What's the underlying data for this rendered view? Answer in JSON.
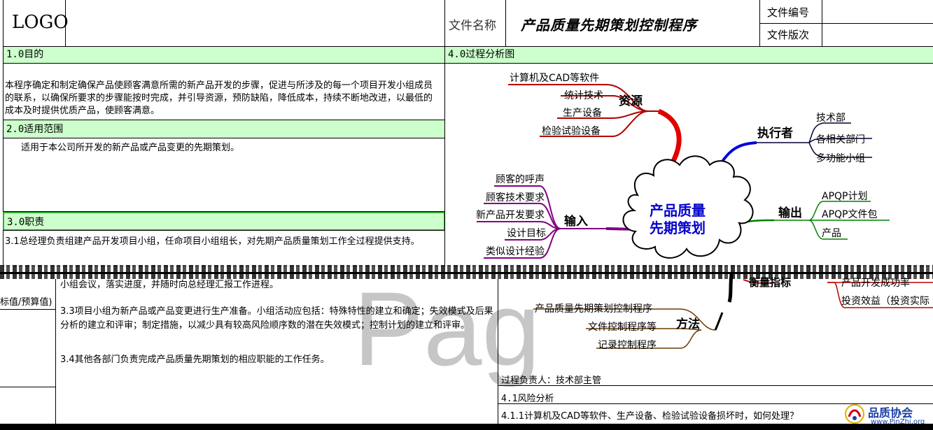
{
  "header": {
    "logo": "LOGO",
    "doc_name_label": "文件名称",
    "doc_title": "产品质量先期策划控制程序",
    "doc_no_label": "文件编号",
    "doc_version_label": "文件版次"
  },
  "left": {
    "s1_title": "1.0目的",
    "s1_body": "本程序确定和制定确保产品使顾客满意所需的新产品开发的步骤，促进与所涉及的每一个项目开发小组成员的联系，以确保所要求的步骤能按时完成，并引导资源，预防缺陷，降低成本，持续不断地改进，以最低的成本及时提供优质产品，使顾客满意。",
    "s2_title": "2.0适用范围",
    "s2_body": "适用于本公司所开发的新产品或产品变更的先期策划。",
    "s3_title": "3.0职责",
    "s3_1": "3.1总经理负责组建产品开发项目小组，任命项目小组组长，对先期产品质量策划工作全过程提供支持。"
  },
  "right": {
    "s4_title": "4.0过程分析图",
    "center_line1": "产品质量",
    "center_line2": "先期策划",
    "resources_label": "资源",
    "resources": [
      "计算机及CAD等软件",
      "统计技术",
      "生产设备",
      "检验试验设备"
    ],
    "executor_label": "执行者",
    "executors": [
      "技术部",
      "各相关部门",
      "多功能小组"
    ],
    "input_label": "输入",
    "inputs": [
      "顾客的呼声",
      "顾客技术要求",
      "新产品开发要求",
      "设计目标",
      "类似设计经验"
    ],
    "output_label": "输出",
    "outputs": [
      "APQP计划",
      "APQP文件包",
      "产品"
    ]
  },
  "lower": {
    "left_col_text": "标值/预算值)",
    "s3_2_tail": "小组会议，落实进度，并随时向总经理汇报工作进程。",
    "s3_3": "3.3项目小组为新产品或产品变更进行生产准备。小组活动应包括：特殊特性的建立和确定；失效模式及后果分析的建立和评审；制定措施，以减少具有较高风险顺序数的潜在失效模式；控制计划的建立和评审。",
    "s3_4": "3.4其他各部门负责完成产品质量先期策划的相应职能的工作任务。",
    "watermark": "Pag",
    "measure_label": "衡量指标",
    "measures": [
      "产品开发成功率",
      "投资效益（投资实际"
    ],
    "method_label": "方法",
    "methods": [
      "产品质量先期策划控制程序",
      "文件控制程序等",
      "记录控制程序"
    ],
    "owner": "过程负责人：技术部主管",
    "risk_title": "4.1风险分析",
    "risk_q": "4.1.1计算机及CAD等软件、生产设备、检验试验设备损坏时，如何处理？",
    "brand_cn": "品质协会",
    "brand_url": "www.PinZhi.org"
  }
}
